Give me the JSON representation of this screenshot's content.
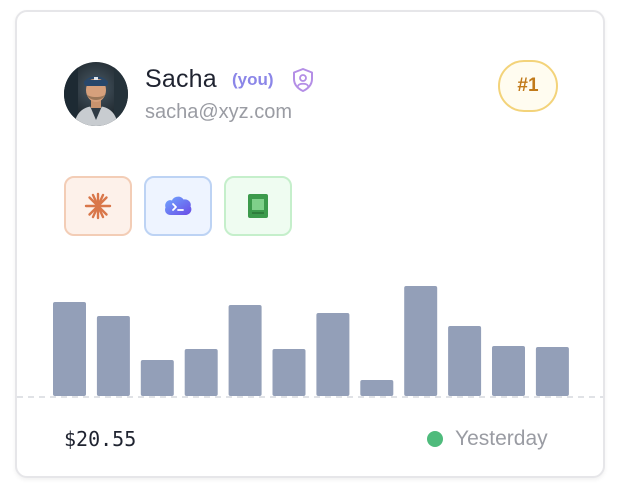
{
  "user": {
    "name": "Sacha",
    "you_label": "(you)",
    "email": "sacha@xyz.com",
    "rank": "#1",
    "avatar_icon": "user-avatar-photo",
    "verified_icon": "shield-user-icon"
  },
  "tools": [
    {
      "icon": "claude-sparkle-icon",
      "color": "#d9774a"
    },
    {
      "icon": "terminal-cloud-icon",
      "color": "#5b6ef0"
    },
    {
      "icon": "sheets-icon",
      "color": "#3c9a4c"
    }
  ],
  "chart_data": {
    "type": "bar",
    "values": [
      94,
      80,
      36,
      47,
      91,
      47,
      83,
      16,
      110,
      70,
      50,
      49
    ],
    "bar_color": "#939fb8",
    "grid": false
  },
  "footer": {
    "amount": "$20.55",
    "status_text": "Yesterday",
    "status_color": "#4fbb7c"
  }
}
